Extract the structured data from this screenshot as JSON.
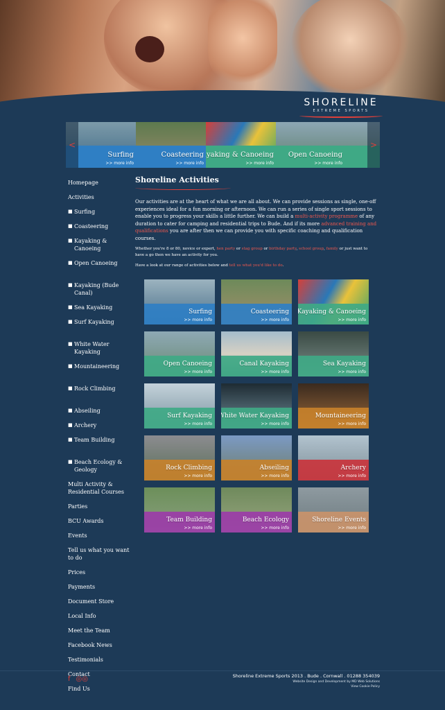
{
  "brand": {
    "name": "SHORELINE",
    "tagline": "EXTREME SPORTS"
  },
  "carousel": {
    "prev_icon": "chevron-left-icon",
    "next_icon": "chevron-right-icon",
    "items": [
      {
        "title": "Surfing",
        "more": ">> more info",
        "band": "#2f7fc4"
      },
      {
        "title": "Coasteering",
        "more": ">> more info",
        "band": "#2f7fc4"
      },
      {
        "title": "Kayaking & Canoeing",
        "more": ">> more info",
        "band": "#3fa985"
      },
      {
        "title": "Open Canoeing",
        "more": ">> more info",
        "band": "#3fa985"
      }
    ]
  },
  "sidebar": {
    "items": [
      {
        "label": "Homepage",
        "sub": false
      },
      {
        "label": "Activities",
        "sub": false
      },
      {
        "label": "Surfing",
        "sub": true
      },
      {
        "label": "Coasteering",
        "sub": true
      },
      {
        "label": "Kayaking & Canoeing",
        "sub": true
      },
      {
        "label": "Open Canoeing",
        "sub": true
      },
      {
        "label": "Kayaking (Bude Canal)",
        "sub": true
      },
      {
        "label": "Sea Kayaking",
        "sub": true
      },
      {
        "label": "Surf Kayaking",
        "sub": true
      },
      {
        "label": "White Water Kayaking",
        "sub": true
      },
      {
        "label": "Mountaineering",
        "sub": true
      },
      {
        "label": "Rock Climbing",
        "sub": true
      },
      {
        "label": "Abseiling",
        "sub": true
      },
      {
        "label": "Archery",
        "sub": true
      },
      {
        "label": "Team Building",
        "sub": true
      },
      {
        "label": "Beach Ecology & Geology",
        "sub": true
      },
      {
        "label": "Multi Activity & Residential Courses",
        "sub": false
      },
      {
        "label": "Parties",
        "sub": false
      },
      {
        "label": "BCU Awards",
        "sub": false
      },
      {
        "label": "Events",
        "sub": false
      },
      {
        "label": "Tell us what you want to do",
        "sub": false
      },
      {
        "label": "Prices",
        "sub": false
      },
      {
        "label": "Payments",
        "sub": false
      },
      {
        "label": "Document Store",
        "sub": false
      },
      {
        "label": "Local Info",
        "sub": false
      },
      {
        "label": "Meet the Team",
        "sub": false
      },
      {
        "label": "Facebook News",
        "sub": false
      },
      {
        "label": "Testimonials",
        "sub": false
      },
      {
        "label": "Contact",
        "sub": false
      },
      {
        "label": "Find Us",
        "sub": false
      }
    ]
  },
  "main": {
    "title": "Shoreline Activities",
    "p1": {
      "a": "Our activities are at the heart of what we are all about. We can provide sessions as single, one-off experiences ideal for a fun morning or afternoon. We can run a series of single sport sessions to enable you to progress your skills a little further. We can build a ",
      "link1": "multi-activity programme",
      "b": " of any duration to cater for camping and residential trips to Bude. And if its more ",
      "link2": "advanced training and qualifications",
      "c": " you are after then we can provide you with specific coaching and qualification courses."
    },
    "p2": {
      "a": "Whether you're 8 or 80, novice or expert, ",
      "l1": "hen party",
      "b": " or ",
      "l2": "stag group",
      "c": " or ",
      "l3": "birthday party",
      "d": ", ",
      "l4": "school group",
      "e": ", ",
      "l5": "family",
      "f": " or just want to have a go then we have an activity for you."
    },
    "p3": {
      "a": "Have a look at our range of activities below and ",
      "link": "tell us what you'd like to do",
      "b": "."
    }
  },
  "tiles": [
    {
      "title": "Surfing",
      "more": ">> more info",
      "band": "#2f7fc4"
    },
    {
      "title": "Coasteering",
      "more": ">> more info",
      "band": "#2f7fc4"
    },
    {
      "title": "Kayaking & Canoeing",
      "more": ">> more info",
      "band": "#3fa985"
    },
    {
      "title": "Open Canoeing",
      "more": ">> more info",
      "band": "#3fa985"
    },
    {
      "title": "Canal Kayaking",
      "more": ">> more info",
      "band": "#3fa985"
    },
    {
      "title": "Sea Kayaking",
      "more": ">> more info",
      "band": "#3fa985"
    },
    {
      "title": "Surf Kayaking",
      "more": ">> more info",
      "band": "#3fa985"
    },
    {
      "title": "White Water Kayaking",
      "more": ">> more info",
      "band": "#3fa985"
    },
    {
      "title": "Mountaineering",
      "more": ">> more info",
      "band": "#c7812b"
    },
    {
      "title": "Rock Climbing",
      "more": ">> more info",
      "band": "#c7812b"
    },
    {
      "title": "Abseiling",
      "more": ">> more info",
      "band": "#c7812b"
    },
    {
      "title": "Archery",
      "more": ">> more info",
      "band": "#c9343c"
    },
    {
      "title": "Team Building",
      "more": ">> more info",
      "band": "#9b3ca8"
    },
    {
      "title": "Beach Ecology",
      "more": ">> more info",
      "band": "#9b3ca8"
    },
    {
      "title": "Shoreline Events",
      "more": ">> more info",
      "band": "#c9936a"
    }
  ],
  "footer": {
    "social": [
      {
        "icon": "facebook-icon",
        "glyph": "f"
      },
      {
        "icon": "tripadvisor-icon",
        "glyph": "◎◎"
      }
    ],
    "line1": "Shoreline Extreme Sports 2013 . Bude . Cornwall . 01288 354039",
    "line2": "Website Design and Development by MD Web Solutions",
    "line3": "View Cookie Policy"
  },
  "colors": {
    "background": "#1d3a57",
    "accent": "#e0403a",
    "link": "#f0584e"
  }
}
